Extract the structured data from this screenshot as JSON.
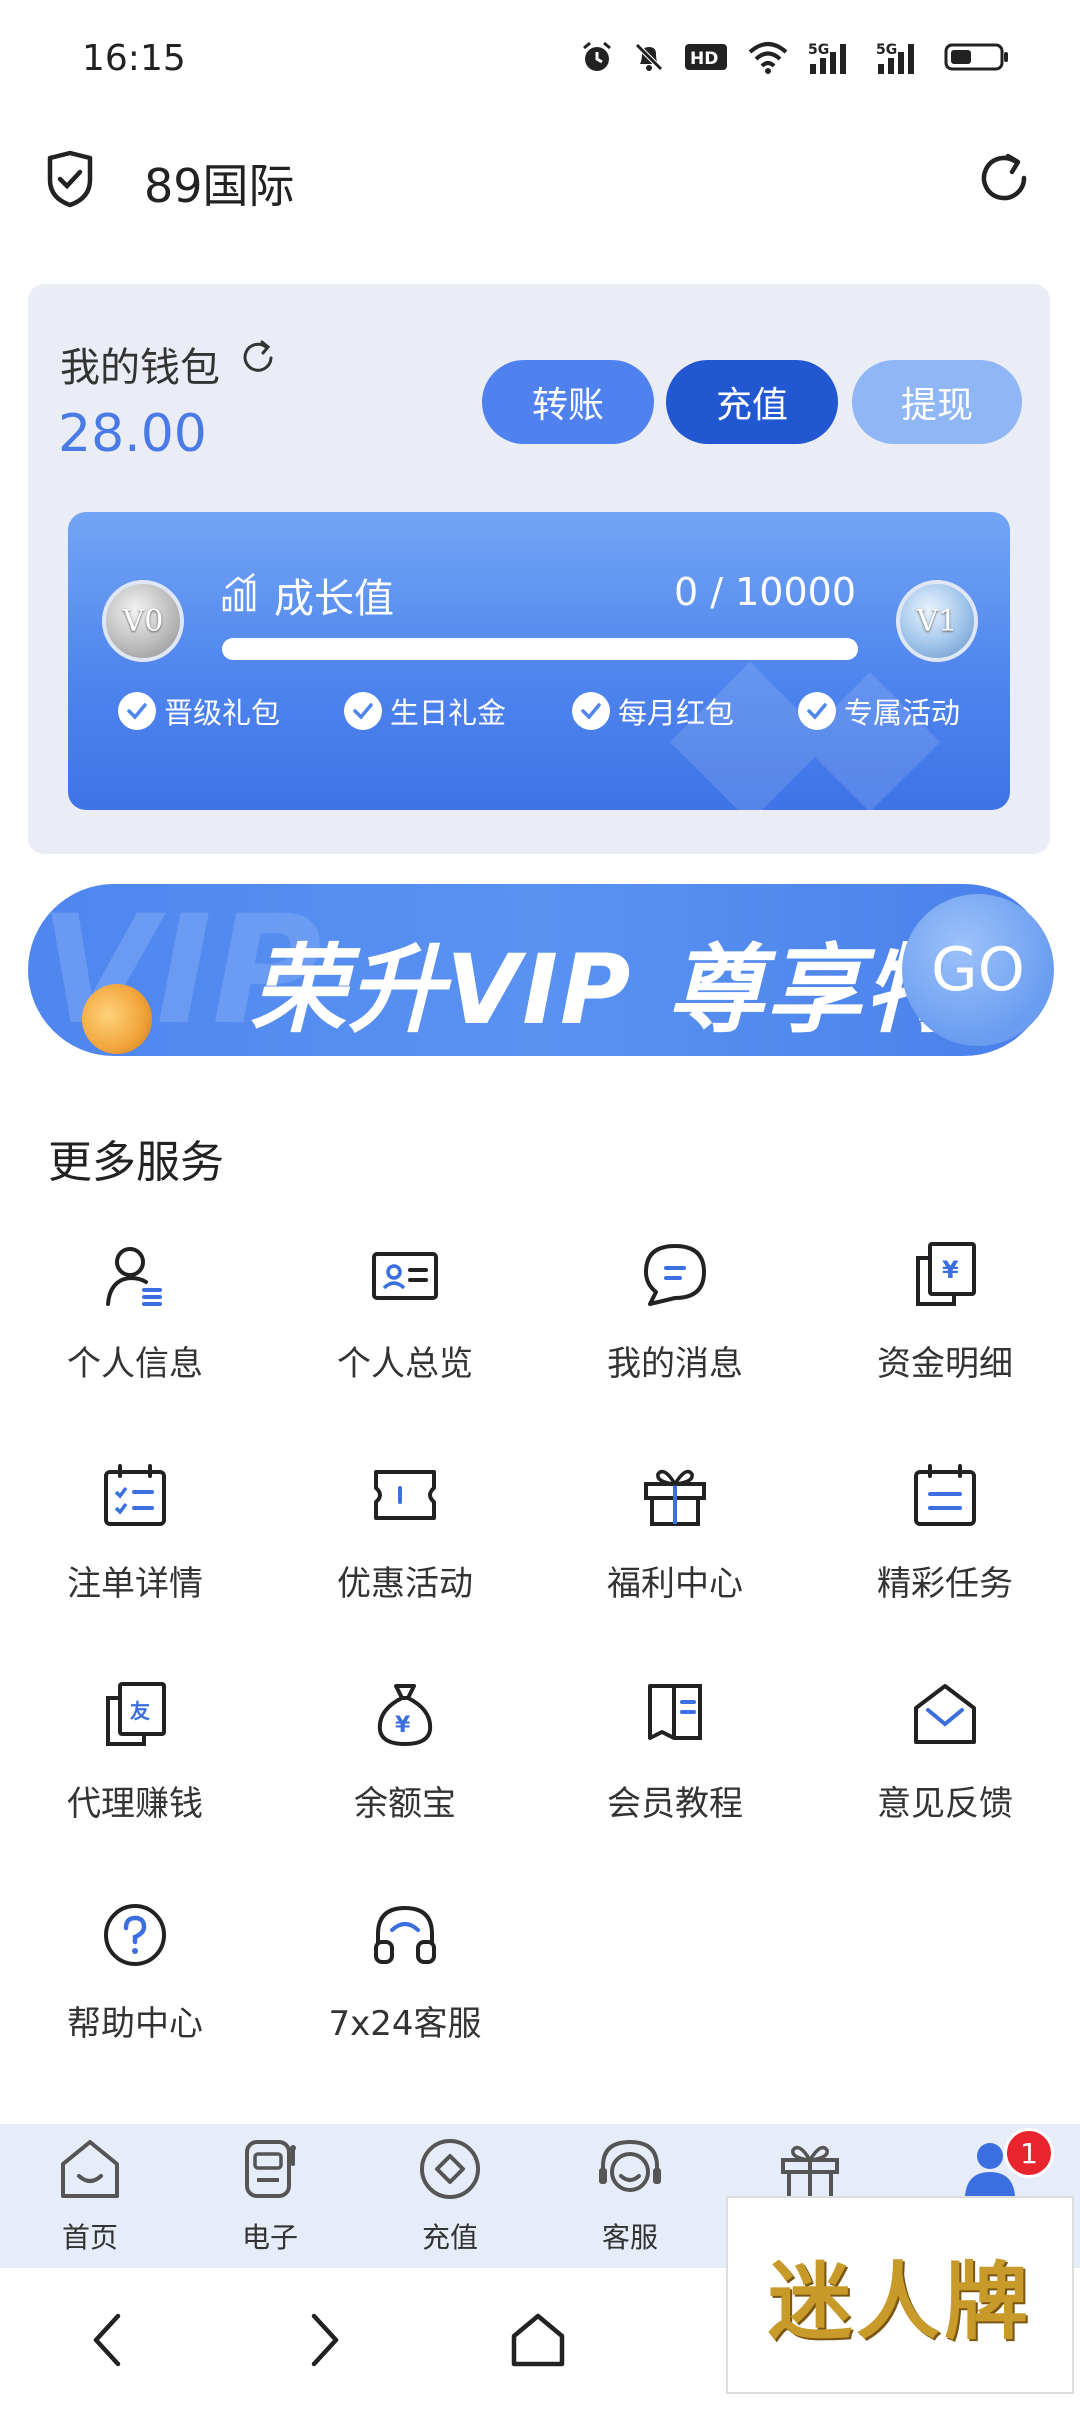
{
  "status_bar": {
    "time": "16:15",
    "network_label_1": "5G",
    "network_label_2": "5G",
    "hd_label": "HD2"
  },
  "header": {
    "title": "89国际"
  },
  "wallet": {
    "label": "我的钱包",
    "amount": "28.00",
    "buttons": {
      "transfer": "转账",
      "deposit": "充值",
      "withdraw": "提现"
    }
  },
  "growth": {
    "label": "成长值",
    "value_text": "0 / 10000",
    "progress": 0,
    "badge_current": "V0",
    "badge_next": "V1",
    "perks": [
      "晋级礼包",
      "生日礼金",
      "每月红包",
      "专属活动"
    ]
  },
  "vip_banner": {
    "bg_text": "VIP",
    "text": "荣升VIP 尊享特权",
    "go_label": "GO"
  },
  "services": {
    "title": "更多服务",
    "items": [
      {
        "label": "个人信息",
        "icon": "user-profile-icon"
      },
      {
        "label": "个人总览",
        "icon": "id-card-icon"
      },
      {
        "label": "我的消息",
        "icon": "message-icon"
      },
      {
        "label": "资金明细",
        "icon": "fund-detail-icon"
      },
      {
        "label": "注单详情",
        "icon": "calendar-check-icon"
      },
      {
        "label": "优惠活动",
        "icon": "ticket-icon"
      },
      {
        "label": "福利中心",
        "icon": "gift-icon"
      },
      {
        "label": "精彩任务",
        "icon": "task-calendar-icon"
      },
      {
        "label": "代理赚钱",
        "icon": "agent-icon"
      },
      {
        "label": "余额宝",
        "icon": "money-bag-icon"
      },
      {
        "label": "会员教程",
        "icon": "book-icon"
      },
      {
        "label": "意见反馈",
        "icon": "mail-icon"
      },
      {
        "label": "帮助中心",
        "icon": "help-icon"
      },
      {
        "label": "7x24客服",
        "icon": "headset-icon"
      }
    ]
  },
  "tab_bar": {
    "items": [
      {
        "label": "首页",
        "icon": "home-icon"
      },
      {
        "label": "电子",
        "icon": "game-machine-icon"
      },
      {
        "label": "充值",
        "icon": "deposit-icon"
      },
      {
        "label": "客服",
        "icon": "service-icon"
      },
      {
        "label": "",
        "icon": "gift-tab-icon"
      },
      {
        "label": "",
        "icon": "profile-tab-icon"
      }
    ],
    "badge_count": "1"
  },
  "overlay": {
    "text": "迷人牌"
  },
  "colors": {
    "accent": "#4f82ef",
    "deposit_blue": "#2257d2",
    "amount_blue": "#4a7ae6",
    "badge_red": "#e8242c"
  }
}
